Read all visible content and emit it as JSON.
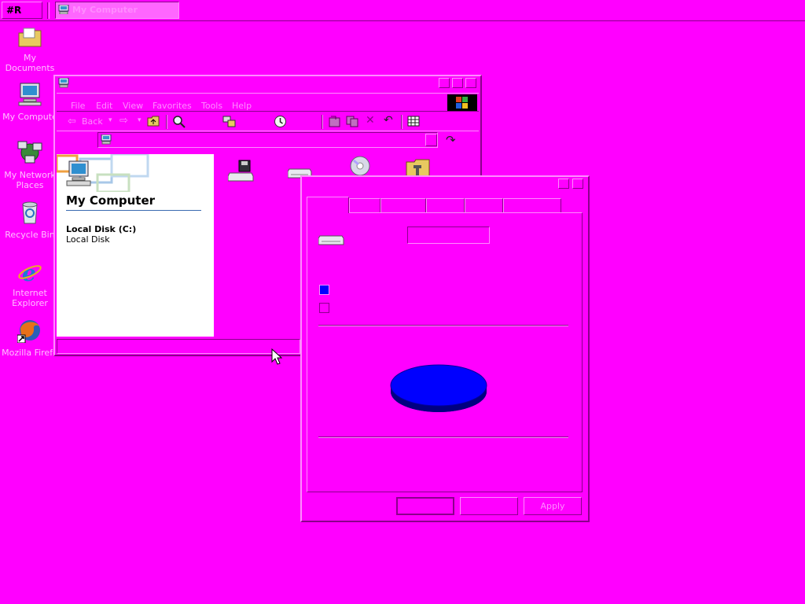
{
  "taskbar": {
    "start_logo": "#R",
    "task_button_label": "My Computer"
  },
  "desktop_icons": [
    {
      "label": "My Documents"
    },
    {
      "label": "My Compute"
    },
    {
      "label": "My Network Places"
    },
    {
      "label": "Recycle Bin"
    },
    {
      "label": "Internet Explorer"
    },
    {
      "label": "Mozilla Firefo"
    }
  ],
  "explorer": {
    "menu": [
      "File",
      "Edit",
      "View",
      "Favorites",
      "Tools",
      "Help"
    ],
    "toolbar": {
      "back_label": "Back"
    },
    "left_panel": {
      "heading": "My Computer",
      "details_title": "Local Disk (C:)",
      "details_subtitle": "Local Disk"
    }
  },
  "properties": {
    "buttons": {
      "ok": "",
      "cancel": "",
      "apply": "Apply"
    }
  },
  "colors": {
    "desktop_bg": "#ff00ff",
    "used_space": "#0000ff",
    "free_space": "#ff00ff",
    "highlight": "#ff8cff",
    "shadow": "#8c008c"
  }
}
